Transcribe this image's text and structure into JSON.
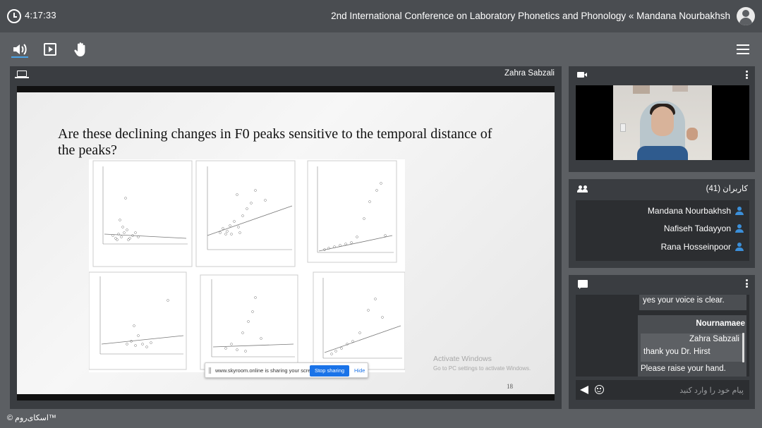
{
  "header": {
    "timer": "4:17:33",
    "title": "2nd International Conference on Laboratory Phonetics and Phonology « Mandana Nourbakhsh"
  },
  "toolbar": {
    "speaker": "speaker-icon",
    "play": "play-icon",
    "hand": "raise-hand-icon",
    "menu": "hamburger-menu-icon"
  },
  "presentation": {
    "presenter": "Zahra Sabzali",
    "slide_title": "Are these declining changes in F0 peaks sensitive to the temporal distance of the peaks?",
    "slide_number": "18",
    "watermark_line1": "Activate Windows",
    "watermark_line2": "Go to PC settings to activate Windows.",
    "share_bar": {
      "text": "www.skyroom.online is sharing your screen.",
      "stop_label": "Stop sharing",
      "hide_label": "Hide"
    }
  },
  "users": {
    "title": "کاربران (41)",
    "list": [
      {
        "name": "Mandana Nourbakhsh"
      },
      {
        "name": "Nafiseh Tadayyon"
      },
      {
        "name": "Rana Hosseinpoor"
      }
    ]
  },
  "chat": {
    "messages": [
      {
        "text": "yes your voice is clear."
      },
      {
        "sender": "Nournamaee"
      },
      {
        "text": "Zahra Sabzali"
      },
      {
        "text": "thank you Dr. Hirst"
      },
      {
        "text": "Please raise your hand."
      }
    ],
    "input_placeholder": "پیام خود را وارد کنید"
  },
  "footer": {
    "brand": "© اسکای‌روم™"
  },
  "colors": {
    "accent": "#4aa3e6",
    "user_icon": "#3b8fd9",
    "background": "#5c5f63",
    "panel": "#3a3d41"
  }
}
